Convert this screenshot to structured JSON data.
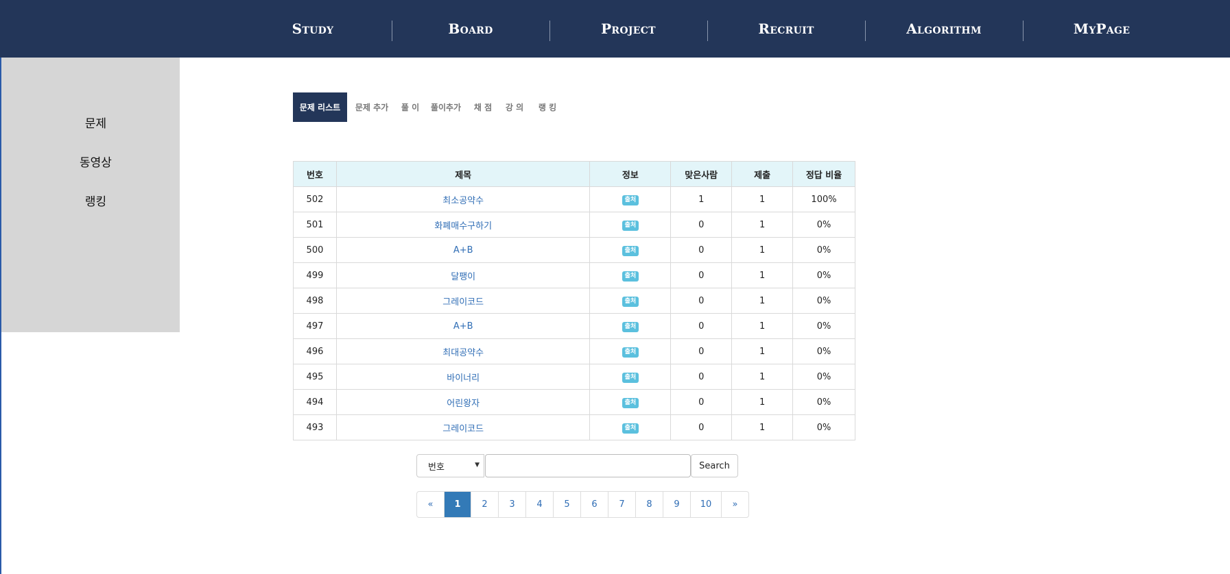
{
  "nav": {
    "items": [
      "Study",
      "Board",
      "Project",
      "Recruit",
      "Algorithm",
      "MyPage"
    ]
  },
  "sidebar": {
    "items": [
      "문제",
      "동영상",
      "랭킹"
    ]
  },
  "tabs": {
    "items": [
      "문제 리스트",
      "문제 추가",
      "풀 이",
      "풀이추가",
      "채 점",
      "강 의",
      "랭 킹"
    ],
    "active_index": 0
  },
  "table": {
    "headers": [
      "번호",
      "제목",
      "정보",
      "맞은사람",
      "제출",
      "정답 비율"
    ],
    "rows": [
      {
        "no": "502",
        "title": "최소공약수",
        "info": "출처",
        "correct": "1",
        "submit": "1",
        "ratio": "100%"
      },
      {
        "no": "501",
        "title": "화폐매수구하기",
        "info": "출처",
        "correct": "0",
        "submit": "1",
        "ratio": "0%"
      },
      {
        "no": "500",
        "title": "A+B",
        "info": "출처",
        "correct": "0",
        "submit": "1",
        "ratio": "0%"
      },
      {
        "no": "499",
        "title": "달팽이",
        "info": "출처",
        "correct": "0",
        "submit": "1",
        "ratio": "0%"
      },
      {
        "no": "498",
        "title": "그레이코드",
        "info": "출처",
        "correct": "0",
        "submit": "1",
        "ratio": "0%"
      },
      {
        "no": "497",
        "title": "A+B",
        "info": "출처",
        "correct": "0",
        "submit": "1",
        "ratio": "0%"
      },
      {
        "no": "496",
        "title": "최대공약수",
        "info": "출처",
        "correct": "0",
        "submit": "1",
        "ratio": "0%"
      },
      {
        "no": "495",
        "title": "바이너리",
        "info": "출처",
        "correct": "0",
        "submit": "1",
        "ratio": "0%"
      },
      {
        "no": "494",
        "title": "어린왕자",
        "info": "출처",
        "correct": "0",
        "submit": "1",
        "ratio": "0%"
      },
      {
        "no": "493",
        "title": "그레이코드",
        "info": "출처",
        "correct": "0",
        "submit": "1",
        "ratio": "0%"
      }
    ]
  },
  "search": {
    "select_value": "번호",
    "input_value": "",
    "button_label": "Search"
  },
  "pagination": {
    "prev": "«",
    "pages": [
      "1",
      "2",
      "3",
      "4",
      "5",
      "6",
      "7",
      "8",
      "9",
      "10"
    ],
    "next": "»",
    "current": "1"
  },
  "colors": {
    "nav_bg": "#233659",
    "sidebar_bg": "#d6d6d6",
    "header_bg": "#e3f5f9",
    "link": "#2f6db5",
    "badge": "#5bc0de",
    "page_active": "#337ab7"
  }
}
